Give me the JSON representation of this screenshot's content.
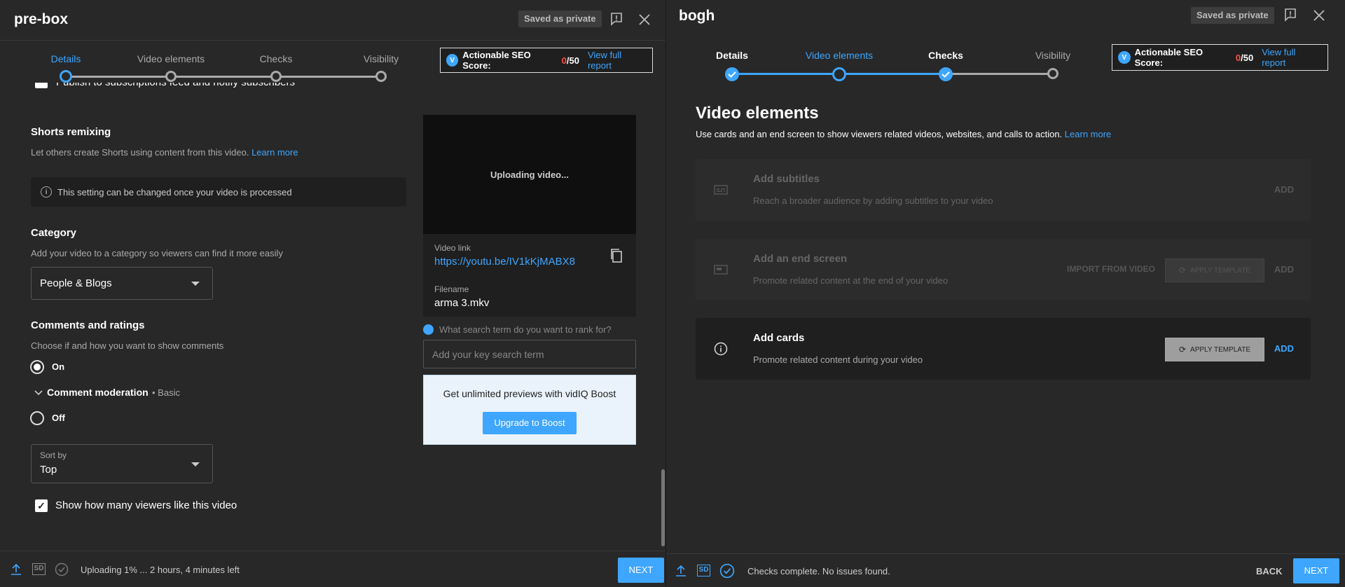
{
  "left": {
    "title": "pre-box",
    "saved": "Saved as private",
    "steps": [
      "Details",
      "Video elements",
      "Checks",
      "Visibility"
    ],
    "seo": {
      "label": "Actionable SEO Score:",
      "score": "0",
      "max": "/50",
      "link": "View full report"
    },
    "partial_checkbox": "Publish to subscriptions feed and notify subscribers",
    "shorts": {
      "title": "Shorts remixing",
      "desc": "Let others create Shorts using content from this video.",
      "learn": "Learn more",
      "note": "This setting can be changed once your video is processed"
    },
    "category": {
      "title": "Category",
      "desc": "Add your video to a category so viewers can find it more easily",
      "value": "People & Blogs"
    },
    "comments": {
      "title": "Comments and ratings",
      "desc": "Choose if and how you want to show comments",
      "on": "On",
      "moderation": "Comment moderation",
      "moderation_level": "• Basic",
      "off": "Off",
      "sort_label": "Sort by",
      "sort_value": "Top",
      "likes": "Show how many viewers like this video"
    },
    "preview": {
      "uploading": "Uploading video...",
      "link_label": "Video link",
      "link": "https://youtu.be/IV1kKjMABX8",
      "file_label": "Filename",
      "file": "arma 3.mkv"
    },
    "keyword": {
      "question": "What search term do you want to rank for?",
      "placeholder": "Add your key search term"
    },
    "boost": {
      "text": "Get unlimited previews with vidIQ Boost",
      "button": "Upgrade to Boost"
    },
    "footer": {
      "badge": "SD",
      "status": "Uploading 1% ... 2 hours, 4 minutes left",
      "next": "NEXT"
    }
  },
  "right": {
    "title": "bogh",
    "saved": "Saved as private",
    "steps": [
      "Details",
      "Video elements",
      "Checks",
      "Visibility"
    ],
    "seo": {
      "label": "Actionable SEO Score:",
      "score": "0",
      "max": "/50",
      "link": "View full report"
    },
    "heading": "Video elements",
    "desc": "Use cards and an end screen to show viewers related videos, websites, and calls to action.",
    "learn": "Learn more",
    "cards": [
      {
        "title": "Add subtitles",
        "desc": "Reach a broader audience by adding subtitles to your video",
        "add": "ADD"
      },
      {
        "title": "Add an end screen",
        "desc": "Promote related content at the end of your video",
        "import": "IMPORT FROM VIDEO",
        "template": "APPLY TEMPLATE",
        "add": "ADD"
      },
      {
        "title": "Add cards",
        "desc": "Promote related content during your video",
        "template": "APPLY TEMPLATE",
        "add": "ADD"
      }
    ],
    "footer": {
      "badge": "SD",
      "status": "Checks complete. No issues found.",
      "back": "BACK",
      "next": "NEXT"
    }
  }
}
